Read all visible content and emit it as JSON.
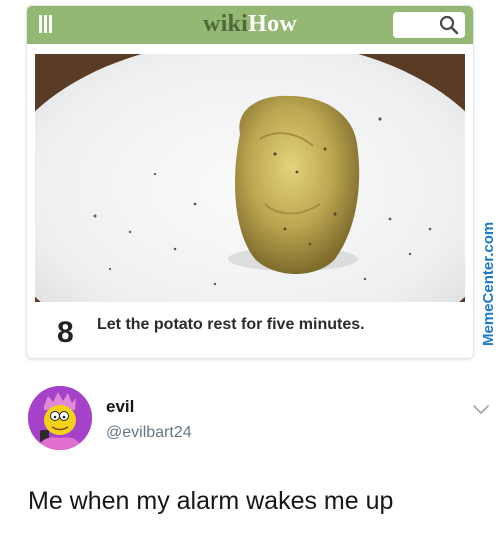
{
  "wikihow": {
    "logo_part1": "wiki",
    "logo_part2": "How",
    "menu_icon": "hamburger-menu-icon",
    "search_icon": "search-icon",
    "colors": {
      "header_green": "#93b874",
      "logo_dark": "#4d6b3a"
    },
    "step": {
      "number": "8",
      "text": "Let the potato rest for five minutes."
    }
  },
  "watermark": {
    "text": "MemeCenter.com",
    "color": "#1a7ac8"
  },
  "tweet": {
    "display_name": "evil",
    "handle": "@evilbart24",
    "text": "Me when my alarm wakes me up",
    "menu_icon": "chevron-down-icon"
  }
}
